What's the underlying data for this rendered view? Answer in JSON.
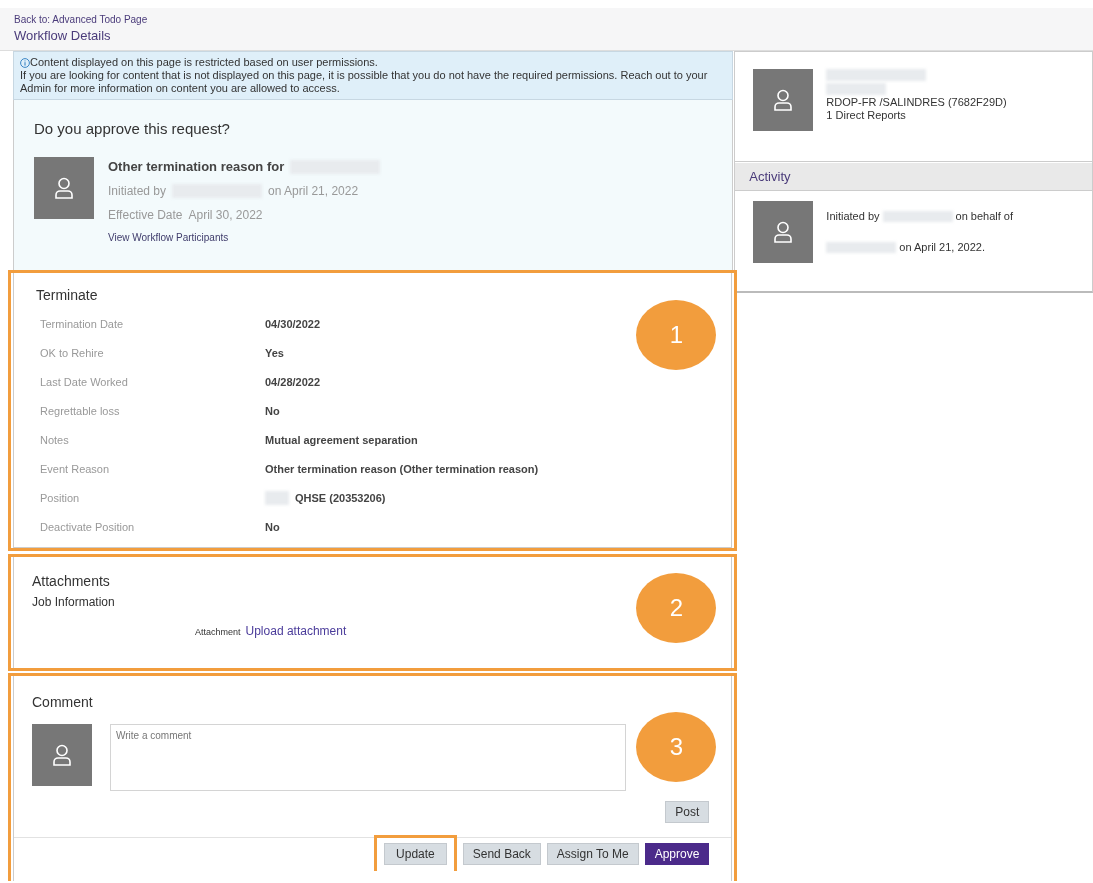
{
  "header": {
    "back_link": "Back to: Advanced Todo Page",
    "title": "Workflow Details"
  },
  "notice": {
    "lines": [
      "Content displayed on this page is restricted based on user permissions.",
      "If you are looking for content that is not displayed on this page, it is possible that you do not have the required permissions. Reach out to your Admin for more information on content you are allowed to access."
    ]
  },
  "request": {
    "question": "Do you approve this request?",
    "subject": [
      {
        "kind": "text",
        "text": "Other termination reason for"
      },
      {
        "kind": "redacted"
      }
    ],
    "initiated": [
      {
        "kind": "text",
        "text": "Initiated by"
      },
      {
        "kind": "redacted"
      },
      {
        "kind": "text",
        "text": "on April 21, 2022"
      }
    ],
    "effective_label": "Effective Date",
    "effective_value": "April 30, 2022",
    "participants_link": "View Workflow Participants"
  },
  "terminate": {
    "title": "Terminate",
    "badge": "1",
    "fields": [
      {
        "label": "Termination Date",
        "value": "04/30/2022"
      },
      {
        "label": "OK to Rehire",
        "value": "Yes"
      },
      {
        "label": "Last Date Worked",
        "value": "04/28/2022"
      },
      {
        "label": "Regrettable loss",
        "value": "No"
      },
      {
        "label": "Notes",
        "value": "Mutual agreement separation"
      },
      {
        "label": "Event Reason",
        "value": "Other termination reason (Other termination reason)"
      },
      {
        "label": "Position",
        "value": "QHSE (20353206)",
        "redacted_prefix": true
      },
      {
        "label": "Deactivate Position",
        "value": "No"
      }
    ]
  },
  "attachments": {
    "title": "Attachments",
    "badge": "2",
    "subtitle": "Job Information",
    "label": "Attachment",
    "link": "Upload attachment"
  },
  "comment": {
    "title": "Comment",
    "badge": "3",
    "placeholder": "Write a comment",
    "post": "Post"
  },
  "actions": [
    {
      "label": "Update",
      "kind": "secondary",
      "highlighted": true
    },
    {
      "label": "Send Back",
      "kind": "secondary",
      "highlighted": false
    },
    {
      "label": "Assign To Me",
      "kind": "secondary",
      "highlighted": false
    },
    {
      "label": "Approve",
      "kind": "primary",
      "highlighted": false
    }
  ],
  "profile": {
    "lines": [
      {
        "kind": "redacted"
      },
      {
        "kind": "redacted"
      },
      {
        "kind": "text",
        "text": "RDOP-FR /SALINDRES (7682F29D)"
      },
      {
        "kind": "text",
        "text": "1 Direct Reports"
      }
    ]
  },
  "activity": {
    "title": "Activity",
    "entries": [
      {
        "parts": [
          {
            "kind": "text",
            "text": "Initiated by"
          },
          {
            "kind": "redacted"
          },
          {
            "kind": "text",
            "text": "on behalf of"
          },
          {
            "kind": "redacted"
          },
          {
            "kind": "text",
            "text": "on April 21, 2022."
          }
        ]
      }
    ]
  }
}
